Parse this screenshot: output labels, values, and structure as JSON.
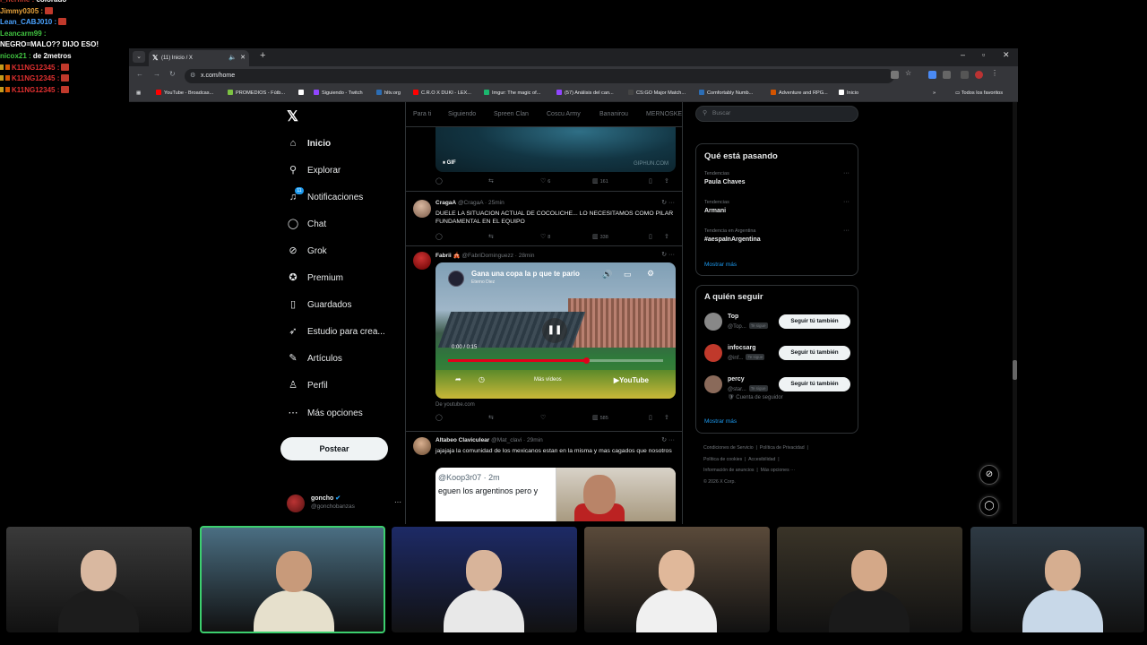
{
  "chat": [
    {
      "user": "i_nerfine",
      "text": "colorado",
      "color": "#c0392b",
      "badge": false
    },
    {
      "user": "Jimmy0305",
      "text": "",
      "color": "#e6a23c",
      "badge": true
    },
    {
      "user": "Lean_CABJ010",
      "text": "",
      "color": "#4aa3ff",
      "badge": true
    },
    {
      "user": "Leancarm99",
      "text": "",
      "color": "#41c441",
      "badge": false
    },
    {
      "user": "NEGRO=MALO?? DIJO ESO!",
      "text": "",
      "color": "#ffffff",
      "badge": false,
      "plain": true
    },
    {
      "user": "nicox21",
      "text": "de 2metros",
      "color": "#41c441",
      "badge": false
    },
    {
      "user": "K11NG12345",
      "text": "",
      "color": "#e03030",
      "badge": true,
      "pre": true
    },
    {
      "user": "K11NG12345",
      "text": "",
      "color": "#e03030",
      "badge": true,
      "pre": true
    },
    {
      "user": "K11NG12345",
      "text": "",
      "color": "#e03030",
      "badge": true,
      "pre": true
    }
  ],
  "browser": {
    "tab_title": "(11) Inicio / X",
    "url": "x.com/home",
    "bookmarks": [
      {
        "label": "YouTube - Broadcas...",
        "color": "#ff0000"
      },
      {
        "label": "PROMEDIOS - Fútb...",
        "color": "#7cc242"
      },
      {
        "label": "",
        "color": "#ffffff"
      },
      {
        "label": "Siguiendo - Twitch",
        "color": "#9146ff"
      },
      {
        "label": "hltv.org",
        "color": "#2c6db4"
      },
      {
        "label": "C.R.O X DUKI - LEX...",
        "color": "#ff0000"
      },
      {
        "label": "Imgur: The magic of...",
        "color": "#1bb76e"
      },
      {
        "label": "(57) Análisis del can...",
        "color": "#9146ff"
      },
      {
        "label": "CS:GO Major Match...",
        "color": "#444444"
      },
      {
        "label": "Comfortably Numb...",
        "color": "#2c6db4"
      },
      {
        "label": "Adventure and RPG...",
        "color": "#d35400"
      },
      {
        "label": "Inicio",
        "color": "#ffffff"
      }
    ],
    "all_bookmarks": "Todos los favoritos"
  },
  "nav": {
    "items": [
      {
        "label": "Inicio",
        "icon": "home-icon",
        "glyph": "⌂"
      },
      {
        "label": "Explorar",
        "icon": "search-icon",
        "glyph": "⚲"
      },
      {
        "label": "Notificaciones",
        "icon": "bell-icon",
        "glyph": "♫"
      },
      {
        "label": "Chat",
        "icon": "chat-icon",
        "glyph": "◯"
      },
      {
        "label": "Grok",
        "icon": "grok-icon",
        "glyph": "⊘"
      },
      {
        "label": "Premium",
        "icon": "premium-icon",
        "glyph": "✪"
      },
      {
        "label": "Guardados",
        "icon": "bookmark-icon",
        "glyph": "▯"
      },
      {
        "label": "Estudio para crea...",
        "icon": "rocket-icon",
        "glyph": "➶"
      },
      {
        "label": "Artículos",
        "icon": "article-icon",
        "glyph": "✎"
      },
      {
        "label": "Perfil",
        "icon": "person-icon",
        "glyph": "♙"
      },
      {
        "label": "Más opciones",
        "icon": "more-circle-icon",
        "glyph": "⋯"
      }
    ],
    "notif_count": "11",
    "post_label": "Postear",
    "account": {
      "name": "goncho",
      "handle": "@gonchobanzas"
    }
  },
  "timeline": {
    "tabs": [
      "Para ti",
      "Siguiendo",
      "Spreen Clan",
      "Coscu Army",
      "Bananirou",
      "MERNOSKE"
    ],
    "gif_post": {
      "gif_label": "GIF",
      "watermark": "GIPHUN.COM",
      "likes": "6",
      "views": "161"
    },
    "post1": {
      "name": "CragaA",
      "handle": "@CragaA",
      "time": "25min",
      "text": "DUELE LA SITUACION ACTUAL DE COCOLICHE... LO NECESITAMOS COMO PILAR FUNDAMENTAL EN EL EQUIPO",
      "likes": "8",
      "views": "338"
    },
    "post2": {
      "name": "Fabrii",
      "handle": "@FabriDominguezz",
      "time": "28min",
      "video_title": "Gana una copa la p que te pario",
      "video_channel": "Eterno Diez",
      "video_time": "0:00 / 0:15",
      "more_videos": "Más vídeos",
      "yt_label": "YouTube",
      "source": "De youtube.com",
      "views": "585"
    },
    "post3": {
      "name": "Altabeo Claviculear",
      "handle": "@Mat_clavi",
      "time": "29min",
      "text": "jajajaja la comunidad de los mexicanos estan en la misma y mas cagados que nosotros",
      "quote_handle": "@Koop3r07 · 2m",
      "quote_text": "eguen los argentinos pero y"
    }
  },
  "right": {
    "search_placeholder": "Buscar",
    "trends_title": "Qué está pasando",
    "trends": [
      {
        "meta": "Tendencias",
        "name": "Paula Chaves"
      },
      {
        "meta": "Tendencias",
        "name": "Armani"
      },
      {
        "meta": "Tendencia en Argentina",
        "name": "#aespaInArgentina"
      }
    ],
    "trends_more": "Mostrar más",
    "follow_title": "A quién seguir",
    "follow": [
      {
        "name": "Top",
        "handle": "@Top...",
        "tag": "Te sigue",
        "button": "Seguir tú también",
        "avatar": "#888888"
      },
      {
        "name": "infocsarg",
        "handle": "@inf...",
        "tag": "Te sigue",
        "button": "Seguir tú también",
        "avatar": "#c0392b"
      },
      {
        "name": "percy",
        "handle": "@star...",
        "tag": "Te sigue",
        "button": "Seguir tú también",
        "avatar": "#8a6a5a",
        "sub": "Cuenta de seguidor"
      }
    ],
    "follow_more": "Mostrar más",
    "footer": [
      "Condiciones de Servicio",
      "Política de Privacidad",
      "Política de cookies",
      "Accesibilidad",
      "Información de anuncios",
      "Más opciones ···",
      "© 2026 X Corp."
    ]
  },
  "cams": [
    {
      "bg": "#3a3a3a",
      "skin": "#d9b8a0",
      "shirt": "#1c1c1c",
      "active": false
    },
    {
      "bg": "#4a6e82",
      "skin": "#c89a7a",
      "shirt": "#e6e0cc",
      "active": true
    },
    {
      "bg": "#1d2a66",
      "skin": "#d8b49a",
      "shirt": "#e8e8e8",
      "active": false
    },
    {
      "bg": "#5a4a3a",
      "skin": "#e0b89a",
      "shirt": "#f0f0f0",
      "active": false
    },
    {
      "bg": "#3a3428",
      "skin": "#d4a888",
      "shirt": "#1a1a1a",
      "active": false
    },
    {
      "bg": "#2e3a44",
      "skin": "#d6ae90",
      "shirt": "#c8d8e8",
      "active": false
    }
  ]
}
